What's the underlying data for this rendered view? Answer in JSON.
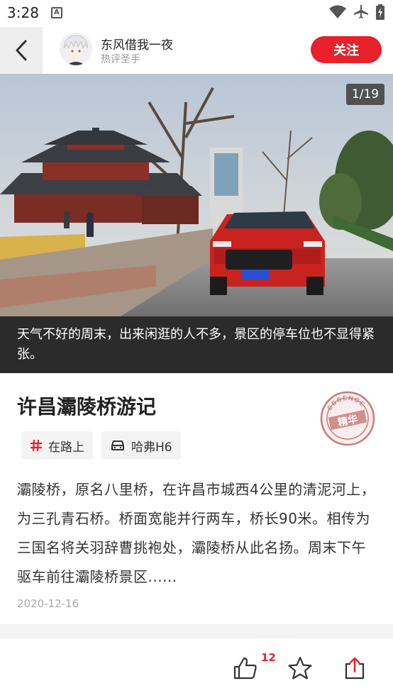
{
  "status_bar": {
    "time": "3:28",
    "notification_letter": "A"
  },
  "header": {
    "author_name": "东风借我一夜",
    "author_tag": "热评圣手",
    "follow_label": "关注"
  },
  "photo": {
    "counter": "1/19",
    "caption": "天气不好的周末，出来闲逛的人不多，景区的停车位也不显得紧张。"
  },
  "article": {
    "title": "许昌灞陵桥游记",
    "badge_text_top": "ESSENCE",
    "badge_text_main": "精华",
    "tags": [
      {
        "label": "在路上",
        "icon": "hashtag-icon"
      },
      {
        "label": "哈弗H6",
        "icon": "car-icon"
      }
    ],
    "body": "灞陵桥，原名八里桥，在许昌市城西4公里的清泥河上，为三孔青石桥。桥面宽能并行两车，桥长90米。相传为三国名将关羽辞曹挑袍处，灞陵桥从此名扬。周末下午驱车前往灞陵桥景区......",
    "date": "2020-12-16"
  },
  "actions": {
    "like_count": "12"
  },
  "colors": {
    "accent": "#e8212a",
    "caption_bg": "#2b2b2b"
  }
}
